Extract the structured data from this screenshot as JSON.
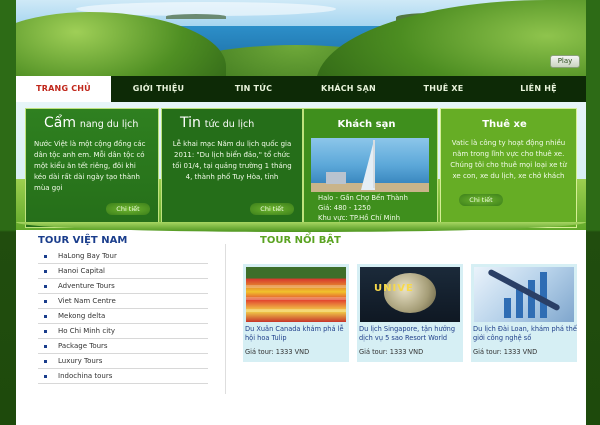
{
  "banner": {
    "play_label": "Play"
  },
  "nav": [
    {
      "label": "TRANG CHỦ",
      "active": true
    },
    {
      "label": "GIỚI THIỆU"
    },
    {
      "label": "TIN TỨC"
    },
    {
      "label": "KHÁCH SẠN"
    },
    {
      "label": "THUÊ XE"
    },
    {
      "label": "LIÊN HỆ"
    }
  ],
  "features": {
    "camnang": {
      "title_big": "Cẩm",
      "title_rest": "nang du lịch",
      "text": "Nước Việt là một cộng đồng các dân tộc anh em. Mỗi dân tộc có một kiểu ăn tết riêng, đôi khi kéo dài rất dài ngày tạo thành mùa gọi",
      "more": "Chi tiết"
    },
    "tintuc": {
      "title_big": "Tin",
      "title_rest": "tức du lịch",
      "text": "Lễ khai mạc Năm du lịch quốc gia 2011: \"Du lịch biển đảo,\" tổ chức tối 01/4, tại quảng trường 1 tháng 4, thành phố Tuy Hòa, tỉnh",
      "more": "Chi tiết"
    },
    "khachsan": {
      "title": "Khách sạn",
      "name": "Halo - Gần Chợ Bến Thành",
      "price": "Giá: 480 - 1250",
      "area": "Khu vực: TP.Hồ Chí Minh"
    },
    "thuexe": {
      "title": "Thuê xe",
      "text": "Vatic là công ty hoạt động nhiều năm trong lĩnh vực cho thuê xe. Chúng tôi cho thuê mọi loại xe từ xe con, xe du lịch, xe chở khách",
      "more": "Chi tiết"
    }
  },
  "tour_vietnam": {
    "title": "TOUR VIỆT NAM",
    "items": [
      "HaLong Bay Tour",
      "Hanoi Capital",
      "Adventure Tours",
      "Viet Nam Centre",
      "Mekong delta",
      "Ho Chi Minh city",
      "Package Tours",
      "Luxury Tours",
      "Indochina tours"
    ]
  },
  "tour_noibat": {
    "title": "TOUR NỔI BẬT",
    "tours": [
      {
        "caption": "Du Xuân Canada khám phá lễ hội hoa Tulip",
        "price": "Giá tour: 1333 VND"
      },
      {
        "caption": "Du lịch Singapore, tận hưởng dịch vụ 5 sao Resort World",
        "price": "Giá tour: 1333 VND"
      },
      {
        "caption": "Du lịch Đài Loan, khám phá thế giới công nghệ số",
        "price": "Giá tour: 1333 VND"
      }
    ],
    "sign_text": "UNIVE"
  }
}
